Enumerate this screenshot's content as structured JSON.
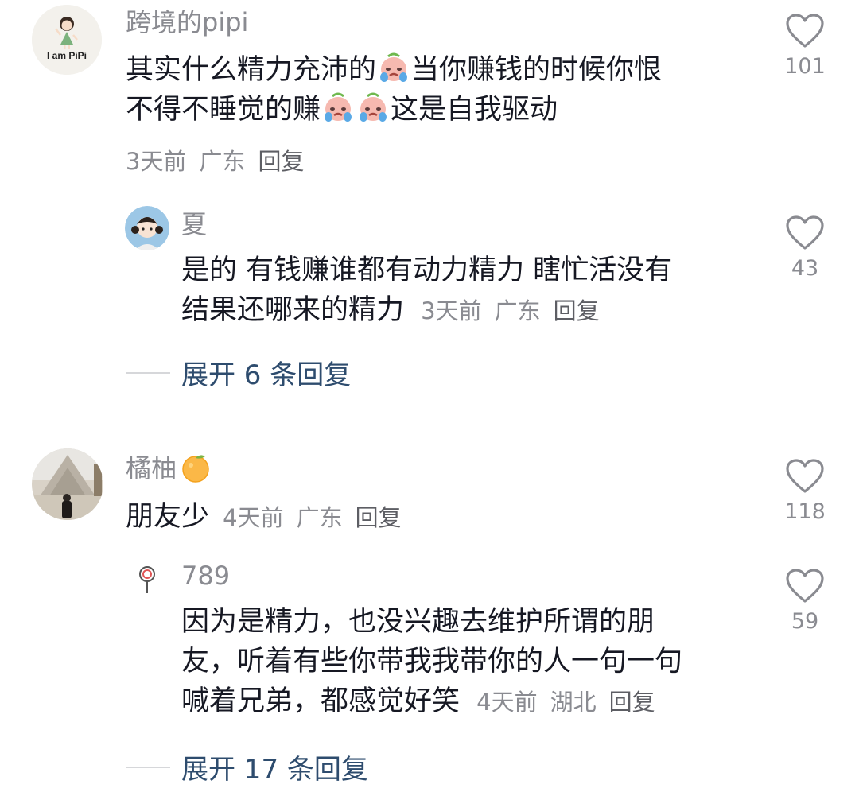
{
  "comments": [
    {
      "username": "跨境的pipi",
      "avatar_text": "I am PiPi",
      "line1_a": "其实什么精力充沛的",
      "line1_b": "当你赚钱的时候你恨",
      "line2_a": "不得不睡觉的赚",
      "line2_b": "这是自我驱动",
      "meta": {
        "time": "3天前",
        "location": "广东",
        "reply": "回复"
      },
      "likes": "101",
      "emoji": "crying-face-icon",
      "replies": [
        {
          "username": "夏",
          "line1": "是的 有钱赚谁都有动力精力 瞎忙活没有",
          "line2": "结果还哪来的精力",
          "meta": {
            "time": "3天前",
            "location": "广东",
            "reply": "回复"
          },
          "likes": "43"
        }
      ],
      "expand_label": "展开 6 条回复"
    },
    {
      "username": "橘柚",
      "username_emoji": "orange-icon",
      "line1": "朋友少",
      "meta": {
        "time": "4天前",
        "location": "广东",
        "reply": "回复"
      },
      "likes": "118",
      "replies": [
        {
          "username": "789",
          "line1": "因为是精力，也没兴趣去维护所谓的朋",
          "line2": "友，听着有些你带我我带你的人一句一句",
          "line3": "喊着兄弟，都感觉好笑",
          "meta": {
            "time": "4天前",
            "location": "湖北",
            "reply": "回复"
          },
          "likes": "59"
        }
      ],
      "expand_label": "展开 17 条回复"
    }
  ],
  "colors": {
    "text": "#161823",
    "secondary": "#8a8b91",
    "expand": "#2e4c6e"
  }
}
